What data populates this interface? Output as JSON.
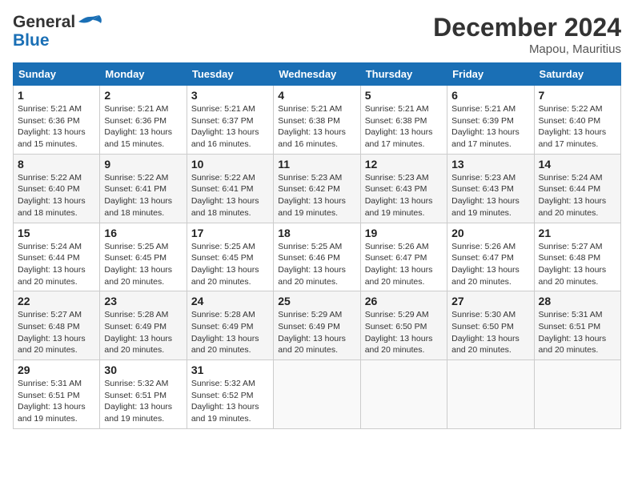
{
  "header": {
    "logo_general": "General",
    "logo_blue": "Blue",
    "title": "December 2024",
    "location": "Mapou, Mauritius"
  },
  "days_of_week": [
    "Sunday",
    "Monday",
    "Tuesday",
    "Wednesday",
    "Thursday",
    "Friday",
    "Saturday"
  ],
  "weeks": [
    [
      {
        "day": "1",
        "sunrise": "5:21 AM",
        "sunset": "6:36 PM",
        "daylight": "13 hours and 15 minutes."
      },
      {
        "day": "2",
        "sunrise": "5:21 AM",
        "sunset": "6:36 PM",
        "daylight": "13 hours and 15 minutes."
      },
      {
        "day": "3",
        "sunrise": "5:21 AM",
        "sunset": "6:37 PM",
        "daylight": "13 hours and 16 minutes."
      },
      {
        "day": "4",
        "sunrise": "5:21 AM",
        "sunset": "6:38 PM",
        "daylight": "13 hours and 16 minutes."
      },
      {
        "day": "5",
        "sunrise": "5:21 AM",
        "sunset": "6:38 PM",
        "daylight": "13 hours and 17 minutes."
      },
      {
        "day": "6",
        "sunrise": "5:21 AM",
        "sunset": "6:39 PM",
        "daylight": "13 hours and 17 minutes."
      },
      {
        "day": "7",
        "sunrise": "5:22 AM",
        "sunset": "6:40 PM",
        "daylight": "13 hours and 17 minutes."
      }
    ],
    [
      {
        "day": "8",
        "sunrise": "5:22 AM",
        "sunset": "6:40 PM",
        "daylight": "13 hours and 18 minutes."
      },
      {
        "day": "9",
        "sunrise": "5:22 AM",
        "sunset": "6:41 PM",
        "daylight": "13 hours and 18 minutes."
      },
      {
        "day": "10",
        "sunrise": "5:22 AM",
        "sunset": "6:41 PM",
        "daylight": "13 hours and 18 minutes."
      },
      {
        "day": "11",
        "sunrise": "5:23 AM",
        "sunset": "6:42 PM",
        "daylight": "13 hours and 19 minutes."
      },
      {
        "day": "12",
        "sunrise": "5:23 AM",
        "sunset": "6:43 PM",
        "daylight": "13 hours and 19 minutes."
      },
      {
        "day": "13",
        "sunrise": "5:23 AM",
        "sunset": "6:43 PM",
        "daylight": "13 hours and 19 minutes."
      },
      {
        "day": "14",
        "sunrise": "5:24 AM",
        "sunset": "6:44 PM",
        "daylight": "13 hours and 20 minutes."
      }
    ],
    [
      {
        "day": "15",
        "sunrise": "5:24 AM",
        "sunset": "6:44 PM",
        "daylight": "13 hours and 20 minutes."
      },
      {
        "day": "16",
        "sunrise": "5:25 AM",
        "sunset": "6:45 PM",
        "daylight": "13 hours and 20 minutes."
      },
      {
        "day": "17",
        "sunrise": "5:25 AM",
        "sunset": "6:45 PM",
        "daylight": "13 hours and 20 minutes."
      },
      {
        "day": "18",
        "sunrise": "5:25 AM",
        "sunset": "6:46 PM",
        "daylight": "13 hours and 20 minutes."
      },
      {
        "day": "19",
        "sunrise": "5:26 AM",
        "sunset": "6:47 PM",
        "daylight": "13 hours and 20 minutes."
      },
      {
        "day": "20",
        "sunrise": "5:26 AM",
        "sunset": "6:47 PM",
        "daylight": "13 hours and 20 minutes."
      },
      {
        "day": "21",
        "sunrise": "5:27 AM",
        "sunset": "6:48 PM",
        "daylight": "13 hours and 20 minutes."
      }
    ],
    [
      {
        "day": "22",
        "sunrise": "5:27 AM",
        "sunset": "6:48 PM",
        "daylight": "13 hours and 20 minutes."
      },
      {
        "day": "23",
        "sunrise": "5:28 AM",
        "sunset": "6:49 PM",
        "daylight": "13 hours and 20 minutes."
      },
      {
        "day": "24",
        "sunrise": "5:28 AM",
        "sunset": "6:49 PM",
        "daylight": "13 hours and 20 minutes."
      },
      {
        "day": "25",
        "sunrise": "5:29 AM",
        "sunset": "6:49 PM",
        "daylight": "13 hours and 20 minutes."
      },
      {
        "day": "26",
        "sunrise": "5:29 AM",
        "sunset": "6:50 PM",
        "daylight": "13 hours and 20 minutes."
      },
      {
        "day": "27",
        "sunrise": "5:30 AM",
        "sunset": "6:50 PM",
        "daylight": "13 hours and 20 minutes."
      },
      {
        "day": "28",
        "sunrise": "5:31 AM",
        "sunset": "6:51 PM",
        "daylight": "13 hours and 20 minutes."
      }
    ],
    [
      {
        "day": "29",
        "sunrise": "5:31 AM",
        "sunset": "6:51 PM",
        "daylight": "13 hours and 19 minutes."
      },
      {
        "day": "30",
        "sunrise": "5:32 AM",
        "sunset": "6:51 PM",
        "daylight": "13 hours and 19 minutes."
      },
      {
        "day": "31",
        "sunrise": "5:32 AM",
        "sunset": "6:52 PM",
        "daylight": "13 hours and 19 minutes."
      },
      null,
      null,
      null,
      null
    ]
  ],
  "labels": {
    "sunrise": "Sunrise:",
    "sunset": "Sunset:",
    "daylight": "Daylight:"
  }
}
